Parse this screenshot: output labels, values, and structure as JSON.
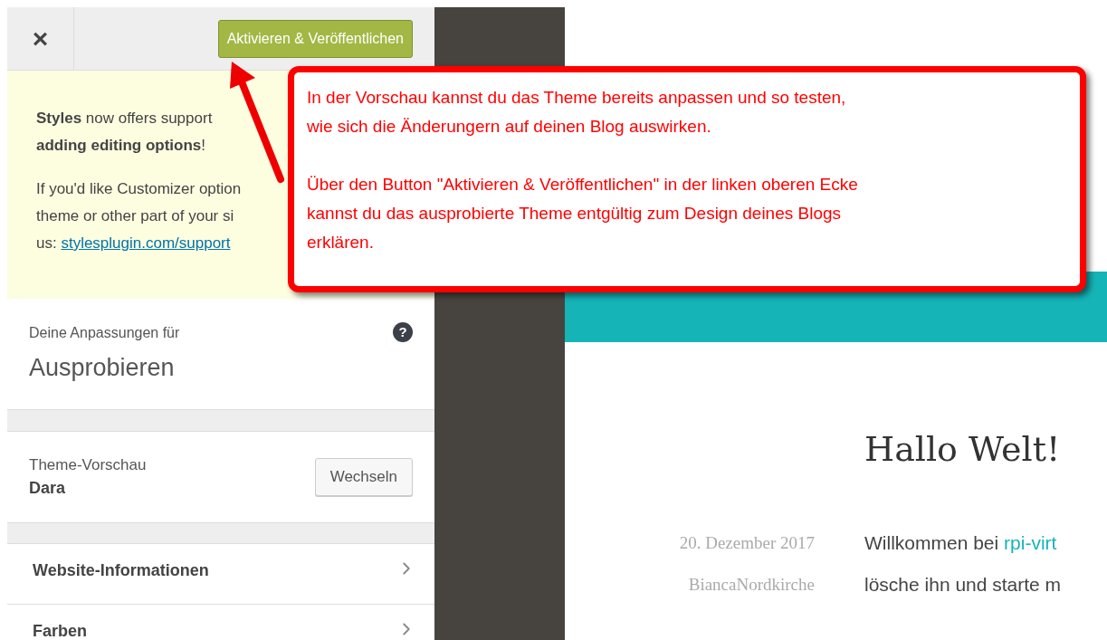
{
  "customizer": {
    "close_label": "×",
    "publish_button": "Aktivieren & Veröffentlichen",
    "notice": {
      "lines": [
        "**Styles** now offers support",
        "**adding editing options**!"
      ],
      "lines2": [
        "If you'd like Customizer option",
        "theme or other part of your si"
      ],
      "link_prefix": "us: ",
      "link": "stylesplugin.com/support"
    },
    "info": {
      "label": "Deine Anpassungen für",
      "title": "Ausprobieren",
      "help": "?"
    },
    "theme": {
      "label": "Theme-Vorschau",
      "name": "Dara",
      "button": "Wechseln"
    },
    "sections": [
      {
        "label": "Website-Informationen"
      },
      {
        "label": "Farben"
      }
    ]
  },
  "preview": {
    "post_title": "Hallo Welt!",
    "date": "20. Dezember 2017",
    "author": "BiancaNordkirche",
    "body_lines": [
      {
        "text": "Willkommen bei ",
        "link": "rpi-virt"
      },
      {
        "text": "lösche ihn und starte m"
      }
    ]
  },
  "callout": {
    "paragraphs": [
      [
        "In der Vorschau kannst du das Theme bereits anpassen und so testen,",
        "wie sich die Änderungern auf deinen Blog auswirken."
      ],
      [
        "Über den Button \"Aktivieren & Veröffentlichen\" in der linken oberen Ecke",
        "kannst du das ausprobierte Theme entgültig zum Design deines Blogs",
        "erklären."
      ]
    ]
  }
}
